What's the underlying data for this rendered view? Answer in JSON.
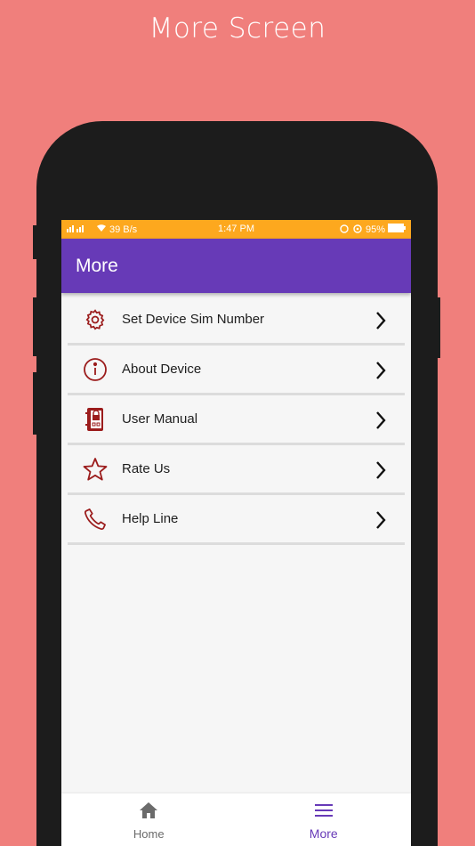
{
  "promo": {
    "title": "More Screen"
  },
  "status_bar": {
    "network_speed": "39 B/s",
    "time": "1:47 PM",
    "battery": "95%"
  },
  "app_bar": {
    "title": "More"
  },
  "menu": {
    "items": [
      {
        "label": "Set Device Sim Number",
        "icon": "gear-icon"
      },
      {
        "label": "About Device",
        "icon": "info-icon"
      },
      {
        "label": "User Manual",
        "icon": "manual-book-icon"
      },
      {
        "label": "Rate Us",
        "icon": "star-icon"
      },
      {
        "label": "Help Line",
        "icon": "phone-icon"
      }
    ]
  },
  "bottom_nav": {
    "home_label": "Home",
    "more_label": "More"
  },
  "colors": {
    "background": "#f07f7c",
    "status_bar": "#fda81e",
    "app_bar": "#673ab7",
    "icon": "#9b1c1c",
    "active_nav": "#673ab7",
    "inactive_nav": "#6b6b6b"
  }
}
